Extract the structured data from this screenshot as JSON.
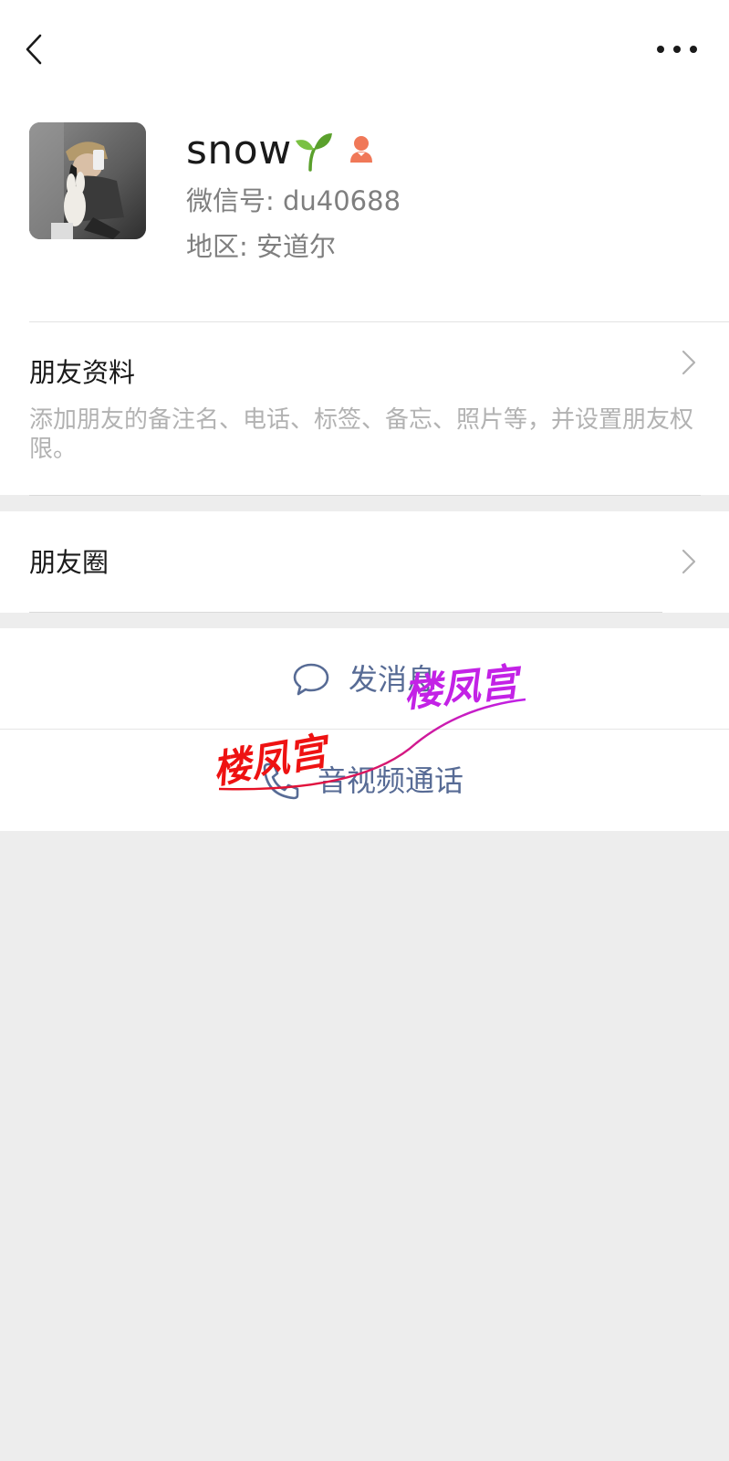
{
  "header": {
    "back_icon": "chevron-left-icon",
    "more_icon": "more-dots-icon"
  },
  "profile": {
    "nickname": "snow",
    "nickname_emoji": "sprout-icon",
    "gender_icon": "female-icon",
    "wechat_id": "微信号: du40688",
    "region": "地区: 安道尔"
  },
  "friend_info": {
    "title": "朋友资料",
    "description": "添加朋友的备注名、电话、标签、备忘、照片等，并设置朋友权限。"
  },
  "moments": {
    "label": "朋友圈"
  },
  "actions": {
    "message_label": "发消息",
    "message_icon": "chat-bubble-icon",
    "call_label": "音视频通话",
    "call_icon": "phone-icon"
  },
  "watermark": {
    "text_1": "楼凤宫",
    "text_2": "楼凤宫"
  },
  "colors": {
    "link_blue": "#576b95",
    "gray_text": "#7f7f7f",
    "light_gray_text": "#b2b2b2",
    "background": "#ededed",
    "gender_icon": "#f07858",
    "sprout": "#7ac142"
  }
}
